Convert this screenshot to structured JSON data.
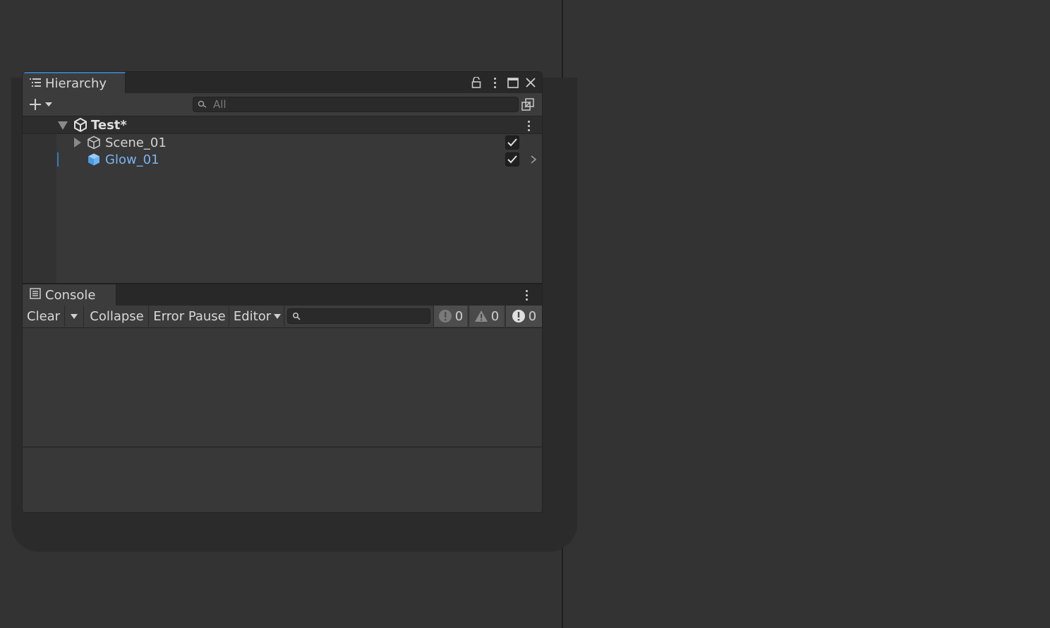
{
  "hierarchy": {
    "tab_label": "Hierarchy",
    "search_placeholder": "All",
    "scene": {
      "name": "Test*"
    },
    "items": [
      {
        "name": "Scene_01",
        "checked": true,
        "icon": "cube-outline-icon"
      },
      {
        "name": "Glow_01",
        "checked": true,
        "icon": "cube-blue-icon",
        "color": "#7ab4f0"
      }
    ]
  },
  "console": {
    "tab_label": "Console",
    "clear_label": "Clear",
    "collapse_label": "Collapse",
    "error_pause_label": "Error Pause",
    "editor_label": "Editor",
    "info_count": "0",
    "warning_count": "0",
    "error_count": "0"
  },
  "colors": {
    "accent": "#3a79bb",
    "selected_text": "#7ab4f0",
    "background": "#333333"
  }
}
